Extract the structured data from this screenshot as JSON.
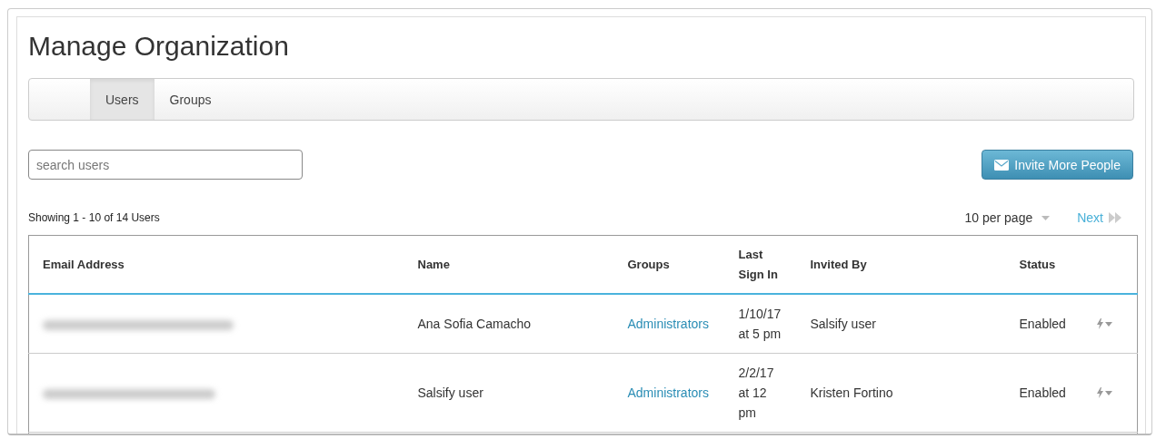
{
  "page": {
    "title": "Manage Organization"
  },
  "tabs": [
    {
      "label": "Users",
      "selected": true
    },
    {
      "label": "Groups",
      "selected": false
    }
  ],
  "search": {
    "placeholder": "search users"
  },
  "invite_button": {
    "label": "Invite More People"
  },
  "summary": "Showing 1 - 10 of 14 Users",
  "pagination": {
    "per_page": "10 per page",
    "next": "Next"
  },
  "table": {
    "columns": [
      "Email Address",
      "Name",
      "Groups",
      "Last Sign In",
      "Invited By",
      "Status"
    ],
    "rows": [
      {
        "name": "Ana Sofia Camacho",
        "groups": "Administrators",
        "last_sign_in": "1/10/17 at 5 pm",
        "invited_by": "Salsify user",
        "status": "Enabled"
      },
      {
        "name": "Salsify user",
        "groups": "Administrators",
        "last_sign_in": "2/2/17 at 12 pm",
        "invited_by": "Kristen Fortino",
        "status": "Enabled"
      }
    ]
  }
}
